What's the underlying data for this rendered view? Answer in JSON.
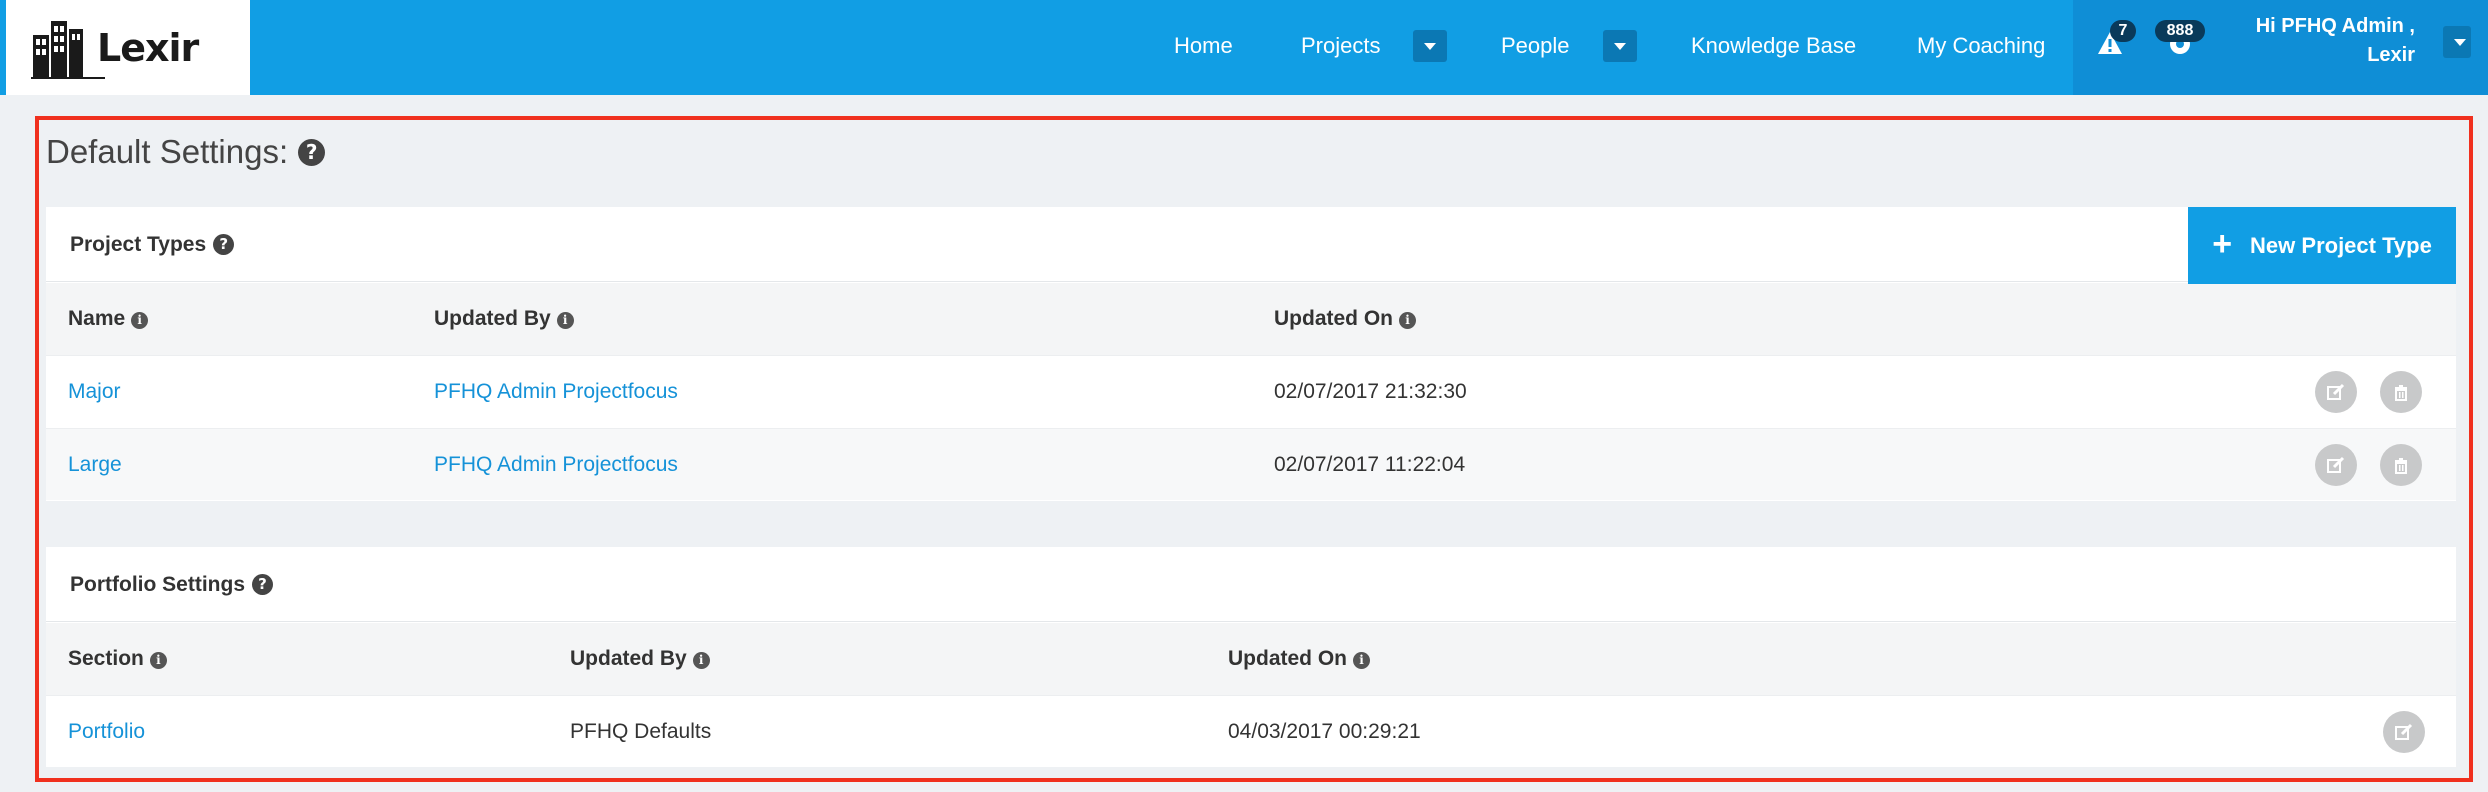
{
  "brand": {
    "name": "Lexir"
  },
  "nav": {
    "home": "Home",
    "projects": "Projects",
    "people": "People",
    "knowledge_base": "Knowledge Base",
    "my_coaching": "My Coaching"
  },
  "notifications": {
    "alerts_count": "7",
    "support_count": "888"
  },
  "user": {
    "greeting_line1": "Hi PFHQ Admin ,",
    "greeting_line2": "Lexir"
  },
  "page": {
    "title": "Default Settings:"
  },
  "project_types": {
    "title": "Project Types",
    "new_button_label": "New Project Type",
    "columns": [
      "Name",
      "Updated By",
      "Updated On"
    ],
    "rows": [
      {
        "name": "Major",
        "updated_by": "PFHQ Admin Projectfocus",
        "updated_on": "02/07/2017 21:32:30"
      },
      {
        "name": "Large",
        "updated_by": "PFHQ Admin Projectfocus",
        "updated_on": "02/07/2017 11:22:04"
      }
    ]
  },
  "portfolio_settings": {
    "title": "Portfolio Settings",
    "columns": [
      "Section",
      "Updated By",
      "Updated On"
    ],
    "rows": [
      {
        "section": "Portfolio",
        "updated_by": "PFHQ Defaults",
        "updated_on": "04/03/2017 00:29:21"
      }
    ]
  },
  "colors": {
    "nav_blue": "#119ee4",
    "nav_dark": "#0f8ed6",
    "link_blue": "#1592d8",
    "highlight_red": "#f0301e",
    "action_grey": "#c8c9ca"
  },
  "icons": [
    "logo-buildings-icon",
    "chevron-down-icon",
    "alert-triangle-icon",
    "support-icon",
    "question-circle-icon",
    "info-circle-icon",
    "plus-icon",
    "edit-icon",
    "trash-icon"
  ]
}
